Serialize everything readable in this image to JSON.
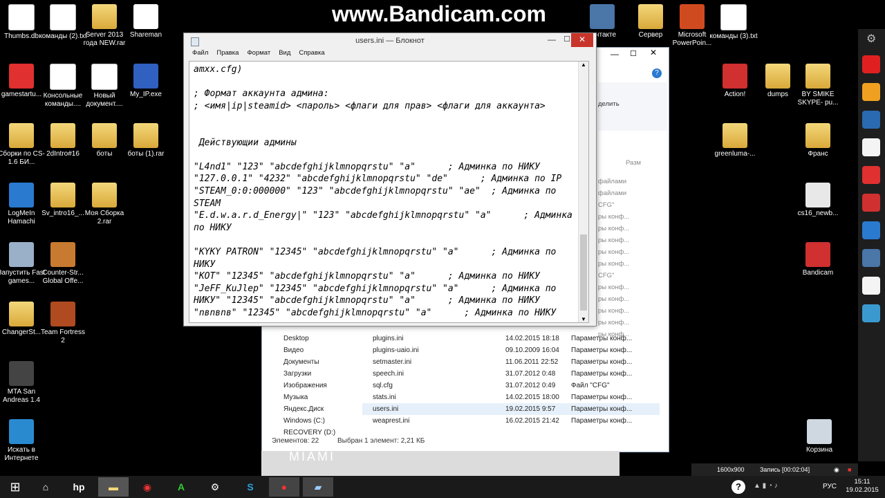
{
  "watermark": "www.Bandicam.com",
  "desktop_icons": [
    {
      "label": "Thumbs.db",
      "kind": "doc",
      "color": "#cfcfcf"
    },
    {
      "label": "команды (2).txt",
      "kind": "doc",
      "color": "#ffffff"
    },
    {
      "label": "Server 2013 года NEW.rar",
      "kind": "folder",
      "color": "#f3d77a"
    },
    {
      "label": "Shareman",
      "kind": "app",
      "color": "#ffffff"
    },
    {
      "label": "gamestartu...",
      "kind": "app",
      "color": "#e03030"
    },
    {
      "label": "Консольные команды....",
      "kind": "doc",
      "color": "#ffffff"
    },
    {
      "label": "Новый документ....",
      "kind": "doc",
      "color": "#6ab0ff"
    },
    {
      "label": "My_IP.exe",
      "kind": "app",
      "color": "#3060c0"
    },
    {
      "label": "Сборки по CS-1.6 БИ...",
      "kind": "folder",
      "color": "#f3d77a"
    },
    {
      "label": "2dIntro#16",
      "kind": "folder",
      "color": "#f3d77a"
    },
    {
      "label": "боты",
      "kind": "folder",
      "color": "#f3d77a"
    },
    {
      "label": "боты (1).rar",
      "kind": "folder",
      "color": "#f3d77a"
    },
    {
      "label": "LogMeIn Hamachi",
      "kind": "app",
      "color": "#2a7ad0"
    },
    {
      "label": "Sv_intro16_...",
      "kind": "folder",
      "color": "#f3d77a"
    },
    {
      "label": "Моя Сборка 2.rar",
      "kind": "folder",
      "color": "#f3d77a"
    },
    {
      "label": "Запустить Fast games...",
      "kind": "app",
      "color": "#9ab0c8"
    },
    {
      "label": "Counter-Str... Global Offe...",
      "kind": "app",
      "color": "#c87a30"
    },
    {
      "label": "ChangerSt...",
      "kind": "folder",
      "color": "#f3d77a"
    },
    {
      "label": "Team Fortress 2",
      "kind": "app",
      "color": "#b04a20"
    },
    {
      "label": "MTA San Andreas 1.4",
      "kind": "app",
      "color": "#444444"
    },
    {
      "label": "Искать в Интернете",
      "kind": "app",
      "color": "#2a8ad0"
    },
    {
      "label": "Сервер",
      "kind": "folder",
      "color": "#f3d77a"
    },
    {
      "label": "Microsoft PowerPoin...",
      "kind": "app",
      "color": "#d04a20"
    },
    {
      "label": "команды (3).txt",
      "kind": "doc",
      "color": "#ffffff"
    },
    {
      "label": "Action!",
      "kind": "app",
      "color": "#d03030"
    },
    {
      "label": "dumps",
      "kind": "folder",
      "color": "#f3d77a"
    },
    {
      "label": "BY SMIKE SKYPE- pu...",
      "kind": "folder",
      "color": "#f3d77a"
    },
    {
      "label": "greenluma-...",
      "kind": "folder",
      "color": "#f3d77a"
    },
    {
      "label": "Франс",
      "kind": "folder",
      "color": "#f3d77a"
    },
    {
      "label": "cs16_newb...",
      "kind": "app",
      "color": "#e8e8e8"
    },
    {
      "label": "Bandicam",
      "kind": "app",
      "color": "#d03030"
    },
    {
      "label": "Корзина",
      "kind": "app",
      "color": "#cfd8e0"
    },
    {
      "label": "контакте",
      "kind": "app",
      "color": "#4a76a8"
    }
  ],
  "notepad": {
    "title": "users.ini — Блокнот",
    "menu": [
      "Файл",
      "Правка",
      "Формат",
      "Вид",
      "Справка"
    ],
    "lines": [
      "amxx.cfg)",
      "",
      "; Формат аккаунта админа:",
      "; <имя|ip|steamid> <пароль> <флаги для прав> <флаги для аккаунта>",
      "",
      "",
      " Действующии админы",
      "",
      "\"L4nd1\" \"123\" \"abcdefghijklmnopqrstu\" \"a\"      ; Админка по НИКУ",
      "\"127.0.0.1\" \"4232\" \"abcdefghijklmnopqrstu\" \"de\"      ; Админка по IP",
      "\"STEAM_0:0:000000\" \"123\" \"abcdefghijklmnopqrstu\" \"ae\"  ; Админка по",
      "STEAM",
      "\"E.d.w.a.r.d_Energy|\" \"123\" \"abcdefghijklmnopqrstu\" \"a\"      ; Админка",
      "по НИКУ",
      "",
      "\"KYKY PATRON\" \"12345\" \"abcdefghijklmnopqrstu\" \"a\"      ; Админка по",
      "НИКУ",
      "\"KOT\" \"12345\" \"abcdefghijklmnopqrstu\" \"a\"      ; Админка по НИКУ",
      "\"JeFF_KuJlep\" \"12345\" \"abcdefghijklmnopqrstu\" \"a\"      ; Админка по",
      "НИКУ\" \"12345\" \"abcdefghijklmnopqrstu\" \"a\"      ; Админка по НИКУ",
      "\"nвnвnв\" \"12345\" \"abcdefghijklmnopqrstu\" \"a\"      ; Админка по НИКУ"
    ]
  },
  "explorer": {
    "tree": [
      "Desktop",
      "Видео",
      "Документы",
      "Загрузки",
      "Изображения",
      "Музыка",
      "Яндекс.Диск",
      "Windows (C:)",
      "RECOVERY (D:)"
    ],
    "files": [
      {
        "name": "plugins.ini",
        "date": "14.02.2015 18:18",
        "type": "Параметры конф..."
      },
      {
        "name": "plugins-uaio.ini",
        "date": "09.10.2009 16:04",
        "type": "Параметры конф..."
      },
      {
        "name": "setmaster.ini",
        "date": "11.06.2011 22:52",
        "type": "Параметры конф..."
      },
      {
        "name": "speech.ini",
        "date": "31.07.2012 0:48",
        "type": "Параметры конф..."
      },
      {
        "name": "sql.cfg",
        "date": "31.07.2012 0:49",
        "type": "Файл \"CFG\""
      },
      {
        "name": "stats.ini",
        "date": "14.02.2015 18:00",
        "type": "Параметры конф..."
      },
      {
        "name": "users.ini",
        "date": "19.02.2015 9:57",
        "type": "Параметры конф..."
      },
      {
        "name": "weaprest.ini",
        "date": "16.02.2015 21:42",
        "type": "Параметры конф..."
      }
    ],
    "right_col": [
      "Разм",
      "файлами",
      "файлами",
      "CFG\"",
      "ры конф...",
      "ры конф...",
      "ры конф...",
      "ры конф...",
      "ры конф...",
      "CFG\"",
      "ры конф...",
      "ры конф...",
      "ры конф...",
      "ры конф...",
      "ры конф..."
    ],
    "delete_label": "делить",
    "status_count": "Элементов: 22",
    "status_selected": "Выбран 1 элемент: 2,21 КБ",
    "miami": "MIAMI"
  },
  "bandicam_bar": {
    "resolution": "1600x900",
    "recording": "Запись [00:02:04]"
  },
  "taskbar": {
    "lang": "РУС",
    "time": "15:11",
    "date": "19.02.2015"
  },
  "sidebar_colors": [
    "#e02020",
    "#f0a020",
    "#2a6ab0",
    "#f4f4f4",
    "#e03030",
    "#d03030",
    "#2a7ad0",
    "#4a76a8",
    "#f4f4f4",
    "#3a9ad0"
  ]
}
